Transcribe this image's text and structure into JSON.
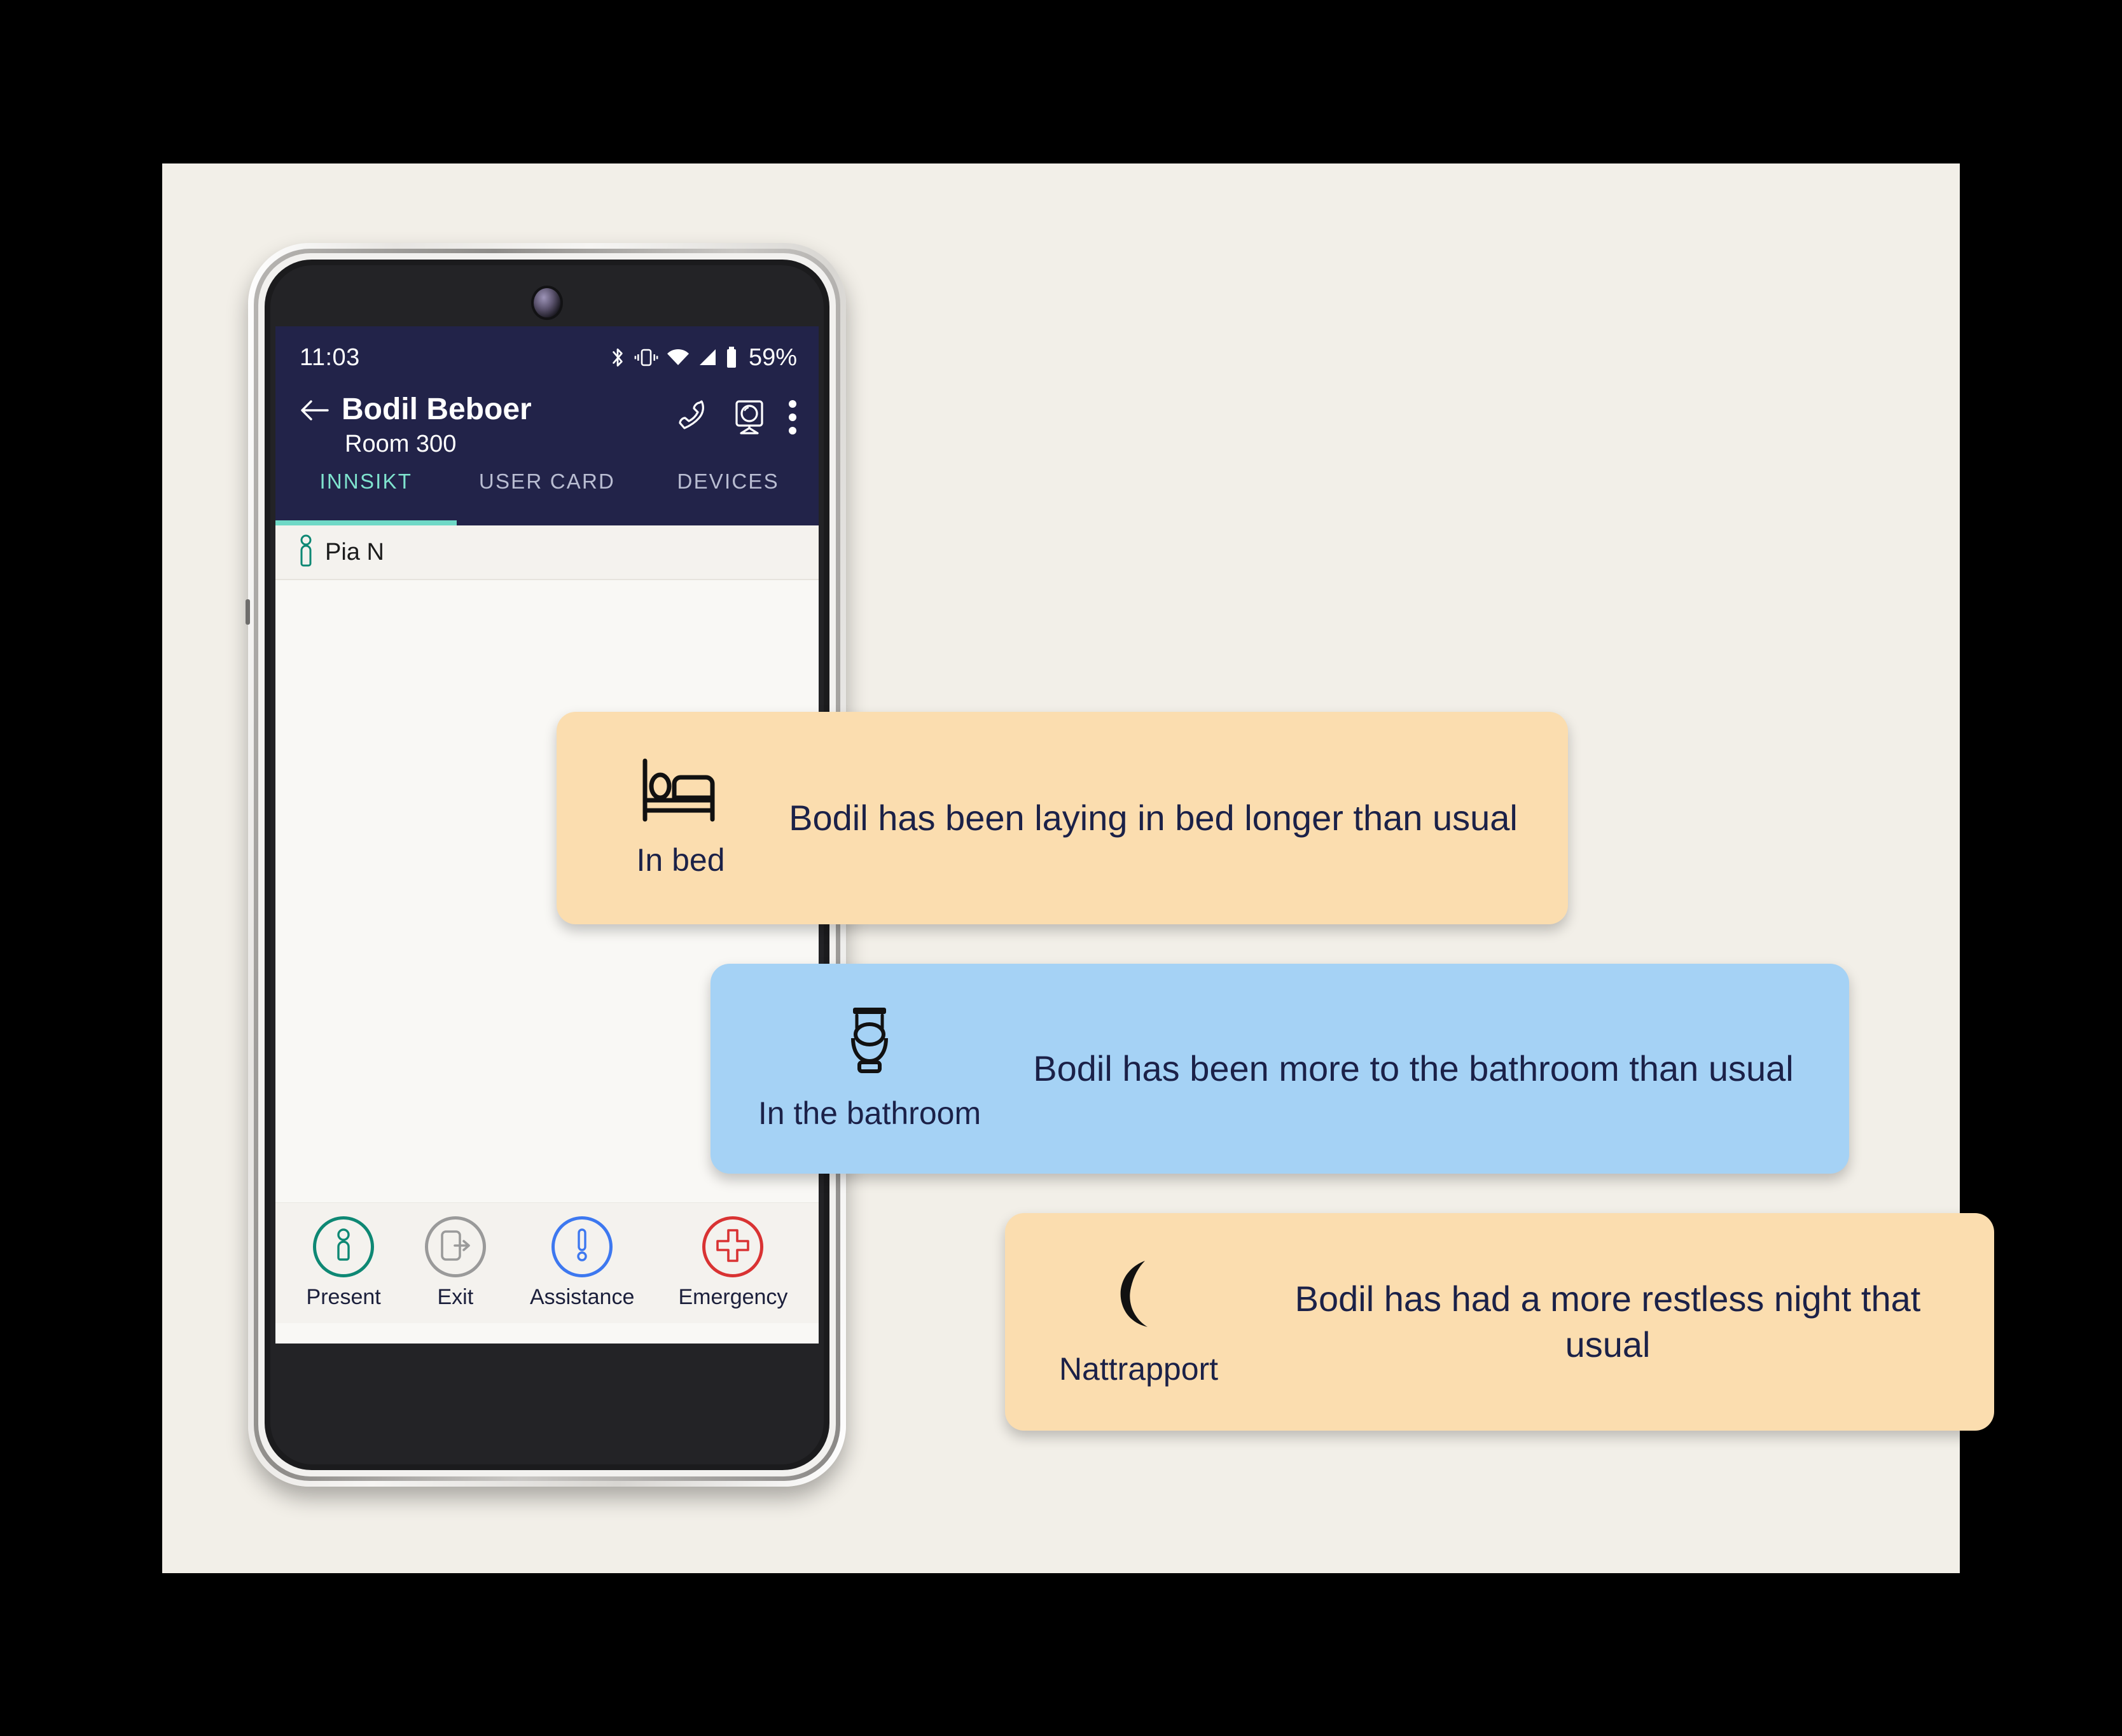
{
  "phone": {
    "status_bar": {
      "time": "11:03",
      "battery_percent": "59%",
      "icons": [
        "bluetooth-icon",
        "vibrate-icon",
        "wifi-icon",
        "cellular-signal-icon",
        "battery-icon"
      ]
    },
    "app_bar": {
      "back_icon": "back-arrow-icon",
      "resident_name": "Bodil Beboer",
      "room": "Room 300",
      "actions": [
        "phone-call-icon",
        "camera-icon",
        "overflow-menu-icon"
      ]
    },
    "tabs": [
      {
        "label": "INNSIKT",
        "active": true
      },
      {
        "label": "USER CARD",
        "active": false
      },
      {
        "label": "DEVICES",
        "active": false
      }
    ],
    "carer_row": {
      "icon": "person-icon",
      "name": "Pia N"
    },
    "action_bar": [
      {
        "label": "Present",
        "icon": "person-icon",
        "color": "#0E8874"
      },
      {
        "label": "Exit",
        "icon": "exit-door-icon",
        "color": "#9A9A9A"
      },
      {
        "label": "Assistance",
        "icon": "exclamation-icon",
        "color": "#3D78F0"
      },
      {
        "label": "Emergency",
        "icon": "medical-cross-icon",
        "color": "#D93333"
      }
    ]
  },
  "callouts": [
    {
      "id": "bed",
      "icon": "bed-icon",
      "label": "In bed",
      "message": "Bodil has been laying in bed longer than usual",
      "background": "#FBDDAF"
    },
    {
      "id": "bathroom",
      "icon": "toilet-icon",
      "label": "In the bathroom",
      "message": "Bodil has been more to the bathroom than usual",
      "background": "#A5D2F5"
    },
    {
      "id": "night",
      "icon": "moon-icon",
      "label": "Nattrapport",
      "message": "Bodil has had a more restless night that usual",
      "background": "#FBDDAF"
    }
  ],
  "colors": {
    "canvas_background": "#F2EFE8",
    "navy": "#222349",
    "teal_accent": "#6FD8C6",
    "screen_background": "#F9F8F5"
  }
}
